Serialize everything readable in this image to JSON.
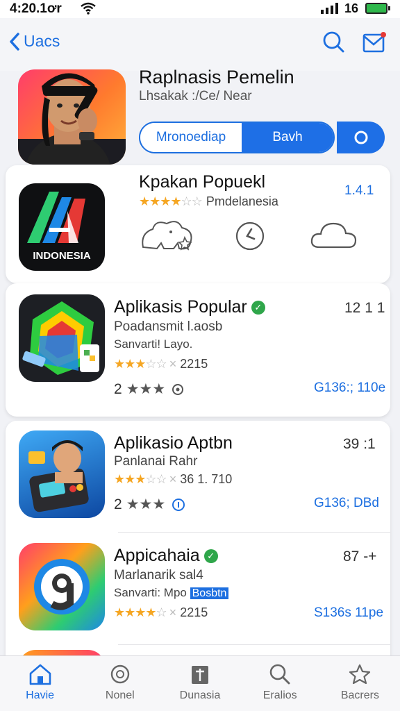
{
  "status": {
    "time": "4:20.1ơr",
    "battery_text": "16"
  },
  "nav": {
    "back_label": "Uacs"
  },
  "hero": {
    "title": "Raplnasis Pemelin",
    "subtitle": "Lhsakak :/Ce/ Near",
    "seg_left": "Mronoediap",
    "seg_right": "Bavh"
  },
  "featured": {
    "title": "Kpakan Popuekl",
    "rank": "1.4.1",
    "rating_text": "Pmdelanesia",
    "icon_text": "INDONESIA"
  },
  "apps": [
    {
      "title": "Aplikasis Popular",
      "rank": "12 1 1",
      "line1": "Poadansmit l.aosb",
      "line2": "Sanvarti! Layo.",
      "rating_text": "2215",
      "rating_num": "2",
      "price": "G136:; 110e"
    },
    {
      "title": "Aplikasio Aptbn",
      "rank": "39 :1",
      "line1": "Panlanai Rahr",
      "rating_text": "36 1. 710",
      "rating_num": "2",
      "price": "G136; DBd"
    },
    {
      "title": "Appicahaia",
      "rank": "87 -+",
      "line1": "Marlanarik sal4",
      "line2_prefix": "Sanvarti: Mpo",
      "line2_highlight": "Bosbtn",
      "rating_text": "2215",
      "price": "S136s 11pe"
    }
  ],
  "tabs": [
    {
      "label": "Havie",
      "icon": "home-icon"
    },
    {
      "label": "Nonel",
      "icon": "badge-icon"
    },
    {
      "label": "Dunasia",
      "icon": "box-icon"
    },
    {
      "label": "Eralios",
      "icon": "search-icon"
    },
    {
      "label": "Bacrers",
      "icon": "star-icon"
    }
  ],
  "colors": {
    "accent": "#1d6fe0",
    "star": "#f5a623",
    "verified": "#2fa64a"
  }
}
